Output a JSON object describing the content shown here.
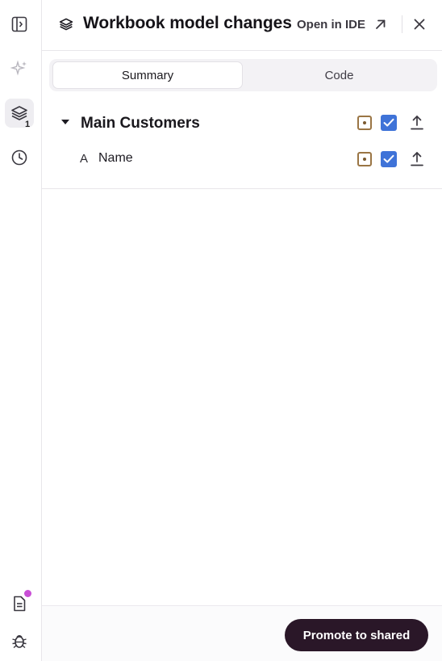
{
  "header": {
    "title": "Workbook model changes",
    "open_ide_label": "Open in IDE"
  },
  "rail": {
    "changes_count": "1"
  },
  "tabs": [
    {
      "label": "Summary",
      "selected": true
    },
    {
      "label": "Code",
      "selected": false
    }
  ],
  "tree": {
    "group": {
      "label": "Main Customers",
      "checked": true
    },
    "items": [
      {
        "type_glyph": "A",
        "label": "Name",
        "checked": true
      }
    ]
  },
  "footer": {
    "promote_label": "Promote to shared"
  },
  "colors": {
    "accent_check": "#3f73d8",
    "primary_button": "#2a1728",
    "notification_dot": "#c94fd6",
    "dice_icon": "#9a7544"
  }
}
